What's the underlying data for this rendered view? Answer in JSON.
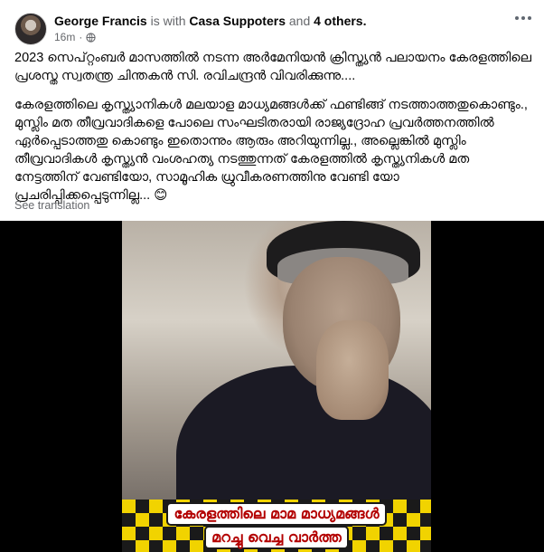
{
  "post": {
    "author": "George Francis",
    "with_text": "is with",
    "tagged_page": "Casa Suppoters",
    "and_text": "and",
    "others": "4 others.",
    "time": "16m",
    "dot": "·",
    "privacy_icon": "globe-icon",
    "more_icon": "more-options-icon",
    "paragraphs": [
      "2023 സെപ്റ്റംബർ മാസത്തിൽ നടന്ന അർമേനിയൻ ക്രിസ്ത്യൻ പലായനം കേരളത്തിലെ പ്രശസ്ത സ്വതന്ത്ര ചിന്തകൻ സി. രവിചന്ദ്രൻ വിവരിക്കുന്നു....",
      "കേരളത്തിലെ കൃസ്ത്യാനികൾ മലയാള മാധ്യമങ്ങൾക്ക് ഫണ്ടിങ്ങ് നടത്താത്തതുകൊണ്ടും., മുസ്ലിം മത തീവ്രവാദികളെ പോലെ സംഘടിതരായി രാജ്യദ്രോഹ പ്രവർത്തനത്തിൽ ഏർപ്പെടാത്തതു കൊണ്ടും ഇതൊന്നും ആരും അറിയുന്നില്ല., അല്ലെങ്കിൽ മുസ്ലിം തീവ്രവാദികൾ കൃസ്ത്യൻ വംശഹത്യ നടത്തുന്നത് കേരളത്തിൽ കൃസ്ത്യനികൾ മത നേട്ടത്തിന് വേണ്ടിയോ, സാമൂഹിക ധ്രുവീകരണത്തിനു വേണ്ടി യോ പ്രചരിപ്പിക്കപ്പെടുന്നില്ല... 😊"
    ],
    "see_translation": "See translation"
  },
  "video": {
    "banner_line1": "കേരളത്തിലെ മാമ മാധ്യമങ്ങൾ",
    "banner_line2": "മറച്ചു വെച്ച വാർത്ത",
    "banner_bg": "#f1d300",
    "banner_text_color": "#b30000"
  }
}
